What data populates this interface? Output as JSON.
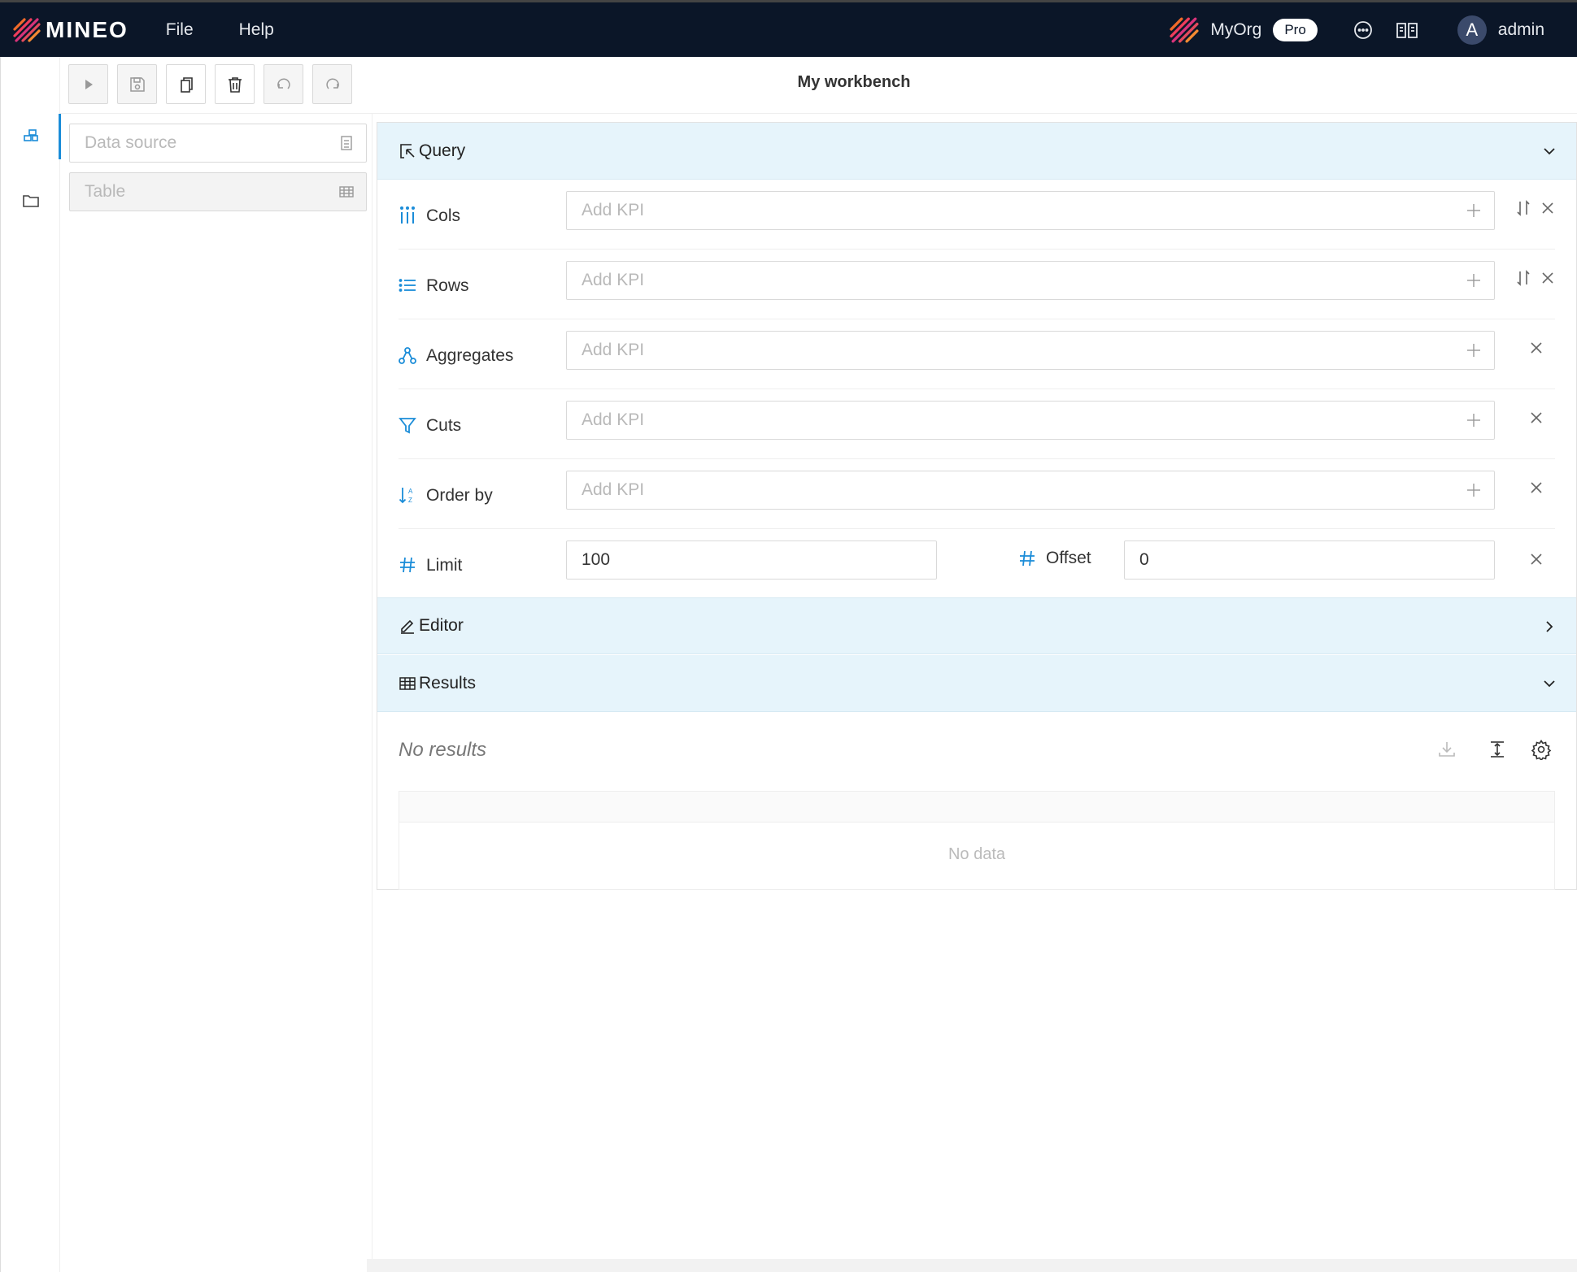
{
  "app": {
    "logo_text": "MINEO",
    "menu": [
      "File",
      "Help"
    ],
    "org_name": "MyOrg",
    "plan_badge": "Pro",
    "avatar_letter": "A",
    "user_name": "admin"
  },
  "page_title": "My workbench",
  "left_panel": {
    "data_source_placeholder": "Data source",
    "table_placeholder": "Table"
  },
  "query": {
    "header": "Query",
    "rows": [
      {
        "label": "Cols",
        "placeholder": "Add KPI"
      },
      {
        "label": "Rows",
        "placeholder": "Add KPI"
      },
      {
        "label": "Aggregates",
        "placeholder": "Add KPI"
      },
      {
        "label": "Cuts",
        "placeholder": "Add KPI"
      },
      {
        "label": "Order by",
        "placeholder": "Add KPI"
      }
    ],
    "limit_label": "Limit",
    "limit_value": "100",
    "offset_label": "Offset",
    "offset_value": "0"
  },
  "editor": {
    "header": "Editor"
  },
  "results": {
    "header": "Results",
    "status": "No results",
    "empty_text": "No data"
  },
  "colors": {
    "topbar": "#0b1628",
    "accent": "#1a8cd8",
    "section_header": "#e6f4fb"
  }
}
